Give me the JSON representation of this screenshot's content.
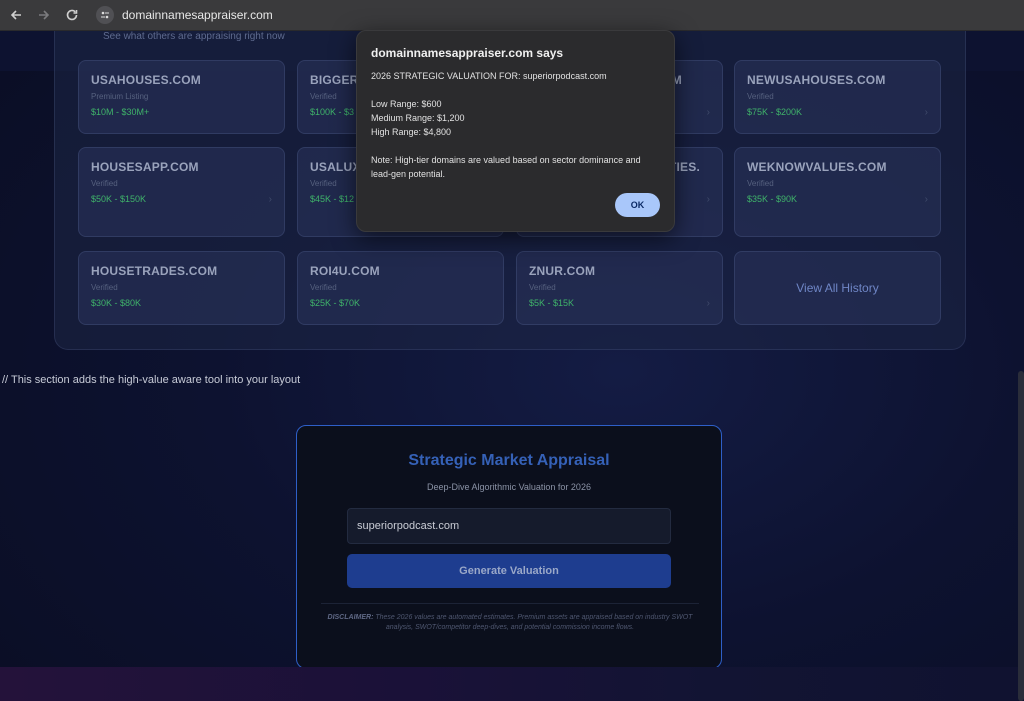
{
  "browser": {
    "url": "domainnamesappraiser.com"
  },
  "recent": {
    "subtitle": "See what others are appraising right now",
    "cards": [
      {
        "name": "USAHOUSES.COM",
        "tag": "Premium Listing",
        "range": "$10M - $30M+"
      },
      {
        "name": "BIGGERS",
        "tag": "Verified",
        "range": "$100K - $3"
      },
      {
        "name": "M",
        "tag": "",
        "range": ""
      },
      {
        "name": "NEWUSAHOUSES.COM",
        "tag": "Verified",
        "range": "$75K - $200K"
      },
      {
        "name": "HOUSESAPP.COM",
        "tag": "Verified",
        "range": "$50K - $150K"
      },
      {
        "name": "USALUX",
        "tag": "Verified",
        "range": "$45K - $12"
      },
      {
        "name": "TIES.",
        "tag": "",
        "range": ""
      },
      {
        "name": "WEKNOWVALUES.COM",
        "tag": "Verified",
        "range": "$35K - $90K"
      },
      {
        "name": "HOUSETRADES.COM",
        "tag": "Verified",
        "range": "$30K - $80K"
      },
      {
        "name": "ROI4U.COM",
        "tag": "Verified",
        "range": "$25K - $70K"
      },
      {
        "name": "ZNUR.COM",
        "tag": "Verified",
        "range": "$5K - $15K"
      }
    ],
    "view_all": "View All History"
  },
  "comment": "// This section adds the high-value aware tool into your layout",
  "appraisal": {
    "title": "Strategic Market Appraisal",
    "subtitle": "Deep-Dive Algorithmic Valuation for 2026",
    "input_value": "superiorpodcast.com",
    "button": "Generate Valuation",
    "disclaimer_label": "DISCLAIMER:",
    "disclaimer_text": "These 2026 values are automated estimates. Premium assets are appraised based on industry SWOT analysis, SWOT/competitor deep-dives, and potential commission income flows."
  },
  "dialog": {
    "title": "domainnamesappraiser.com says",
    "line1": "2026 STRATEGIC VALUATION FOR: superiorpodcast.com",
    "low": "Low Range: $600",
    "medium": "Medium Range: $1,200",
    "high": "High Range: $4,800",
    "note": "Note: High-tier domains are valued based on sector dominance and lead-gen potential.",
    "ok": "OK"
  }
}
